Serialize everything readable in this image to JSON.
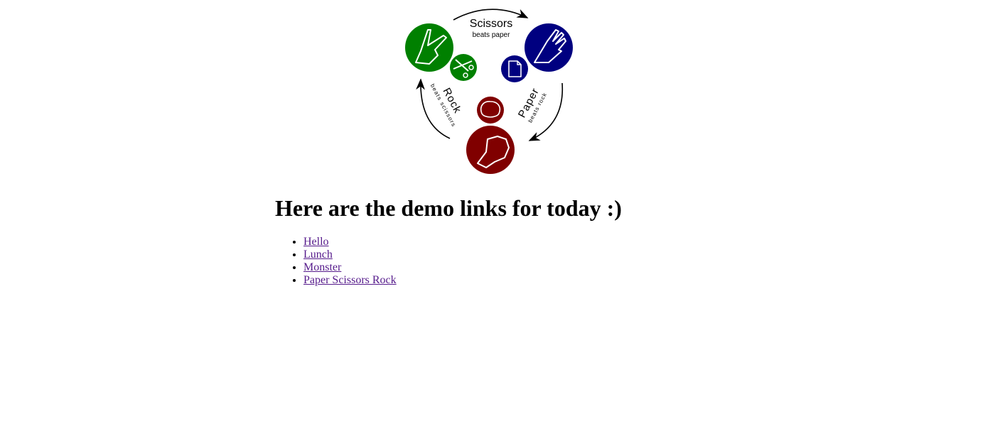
{
  "diagram": {
    "scissors": {
      "label": "Scissors",
      "sublabel": "beats paper",
      "color": "#008000"
    },
    "paper": {
      "label": "Paper",
      "sublabel": "beats rock",
      "color": "#000080"
    },
    "rock": {
      "label": "Rock",
      "sublabel": "beats scissors",
      "color": "#800000"
    }
  },
  "heading": "Here are the demo links for today :)",
  "links": [
    {
      "label": "Hello"
    },
    {
      "label": "Lunch"
    },
    {
      "label": "Monster"
    },
    {
      "label": "Paper Scissors Rock"
    }
  ]
}
